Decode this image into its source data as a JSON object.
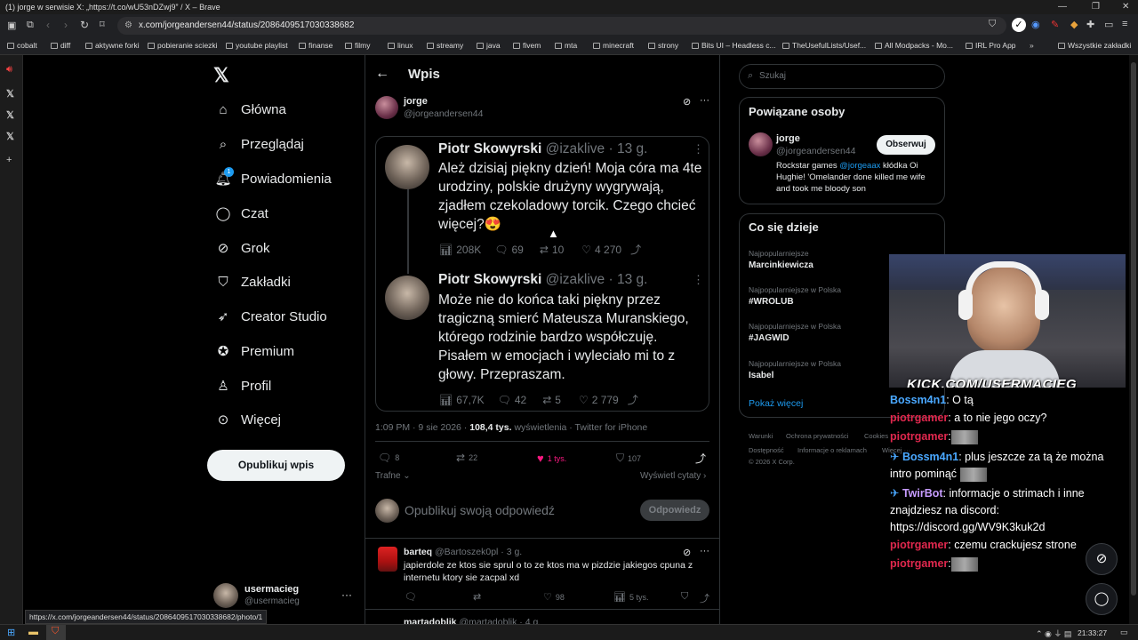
{
  "window": {
    "title": "(1) jorge w serwisie X: „https://t.co/wU53nDZwj9” / X – Brave"
  },
  "browser": {
    "url": "x.com/jorgeandersen44/status/2086409517030338682"
  },
  "bookmarks": [
    "cobalt",
    "diff",
    "aktywne forki",
    "pobieranie sciezki",
    "youtube playlist",
    "finanse",
    "filmy",
    "linux",
    "streamy",
    "java",
    "fivem",
    "mta",
    "minecraft",
    "strony",
    "Bits UI – Headless c...",
    "TheUsefulLists/Usef...",
    "All Modpacks - Mo...",
    "IRL Pro App",
    "Wszystkie zakładki"
  ],
  "nav": {
    "items": [
      "Główna",
      "Przeglądaj",
      "Powiadomienia",
      "Czat",
      "Grok",
      "Zakładki",
      "Creator Studio",
      "Premium",
      "Profil",
      "Więcej"
    ],
    "notification_badge": "1",
    "post_button": "Opublikuj wpis"
  },
  "account": {
    "name": "usermacieg",
    "handle": "@usermacieg"
  },
  "header": {
    "title": "Wpis"
  },
  "post": {
    "author_name": "jorge",
    "author_handle": "@jorgeandersen44",
    "meta_time": "1:09 PM · 9 sie 2026 · ",
    "meta_views": "108,4 tys.",
    "meta_views_label": " wyświetlenia · ",
    "meta_client": "Twitter for iPhone",
    "replies": "8",
    "reposts": "22",
    "likes": "1 tys.",
    "bookmarks": "107",
    "sort_label": "Trafne",
    "view_quotes": "Wyświetl cytaty"
  },
  "quoted": [
    {
      "name": "Piotr Skowyrski",
      "handle": "@izaklive",
      "time": "· 13 g.",
      "text": "Ależ dzisiaj piękny dzień! Moja córa ma 4te urodziny, polskie drużyny wygrywają, zjadłem czekoladowy torcik. Czego chcieć więcej?😍",
      "views": "208K",
      "replies": "69",
      "reposts": "10",
      "likes": "4 270"
    },
    {
      "name": "Piotr Skowyrski",
      "handle": "@izaklive",
      "time": "· 13 g.",
      "text": "Może nie do końca taki piękny przez tragiczną smierć Mateusza Muranskiego, którego rodzinie bardzo współczuję. Pisałem w emocjach i wyleciało mi to z głowy. Przepraszam.",
      "views": "67,7K",
      "replies": "42",
      "reposts": "5",
      "likes": "2 779"
    }
  ],
  "reply_box": {
    "placeholder": "Opublikuj swoją odpowiedź",
    "button": "Odpowiedz"
  },
  "replies": [
    {
      "name": "barteq",
      "handle": "@Bartoszek0pl",
      "time": "· 3 g.",
      "text": "japierdole ze ktos sie sprul o to ze ktos ma w pizdzie jakiegos cpuna z internetu ktory sie zacpal xd",
      "likes": "98",
      "views": "5 tys."
    },
    {
      "name": "martadoblik",
      "handle": "@martadoblik",
      "time": "· 4 g."
    }
  ],
  "search": {
    "placeholder": "Szukaj"
  },
  "related": {
    "title": "Powiązane osoby",
    "name": "jorge",
    "handle": "@jorgeandersen44",
    "follow": "Obserwuj",
    "bio_1": "Rockstar games ",
    "bio_mention": "@jorgeaax",
    "bio_2": " kłódka Oi Hughie! 'Omelander done killed me wife and took me bloody son"
  },
  "trends": {
    "title": "Co się dzieje",
    "items": [
      {
        "category": "Najpopularniejsze",
        "name": "Marcinkiewicza"
      },
      {
        "category": "Najpopularniejsze w Polska",
        "name": "#WROLUB"
      },
      {
        "category": "Najpopularniejsze w Polska",
        "name": "#JAGWID"
      },
      {
        "category": "Najpopularniejsze w Polska",
        "name": "Isabel"
      }
    ],
    "show_more": "Pokaż więcej"
  },
  "footer": [
    "Warunki",
    "Ochrona prywatności",
    "Cookies",
    "Dostępność",
    "Informacje o reklamach",
    "Więcej ···",
    "© 2026 X Corp."
  ],
  "stream": {
    "overlay": "KICK.COM/USERMACIEG"
  },
  "chat": [
    {
      "user": "Bossm4n1",
      "msg": ": O tą",
      "cls": "u2"
    },
    {
      "user": "piotrgamer",
      "msg": ": a to nie jego oczy?",
      "cls": "u1"
    },
    {
      "user": "piotrgamer",
      "msg": ":",
      "cls": "u1"
    },
    {
      "user": "Bossm4n1",
      "msg": ": plus jeszcze za tą że można intro pominąć",
      "cls": "u2"
    },
    {
      "user": "TwirBot",
      "msg": ": informacje o strimach i inne znajdziesz na discord: https://discord.gg/WV9K3kuk2d",
      "cls": "u3"
    },
    {
      "user": "piotrgamer",
      "msg": ": czemu crackujesz strone",
      "cls": "u1"
    },
    {
      "user": "piotrgamer",
      "msg": ":",
      "cls": "u1"
    }
  ],
  "status_url": "https://x.com/jorgeandersen44/status/2086409517030338682/photo/1",
  "taskbar": {
    "clock": "21:33:27"
  },
  "colors": {
    "accent": "#1d9bf0",
    "like": "#f91880",
    "chat_red": "#e0284e",
    "chat_blue": "#4aa8ff",
    "chat_purple": "#c79cff"
  }
}
